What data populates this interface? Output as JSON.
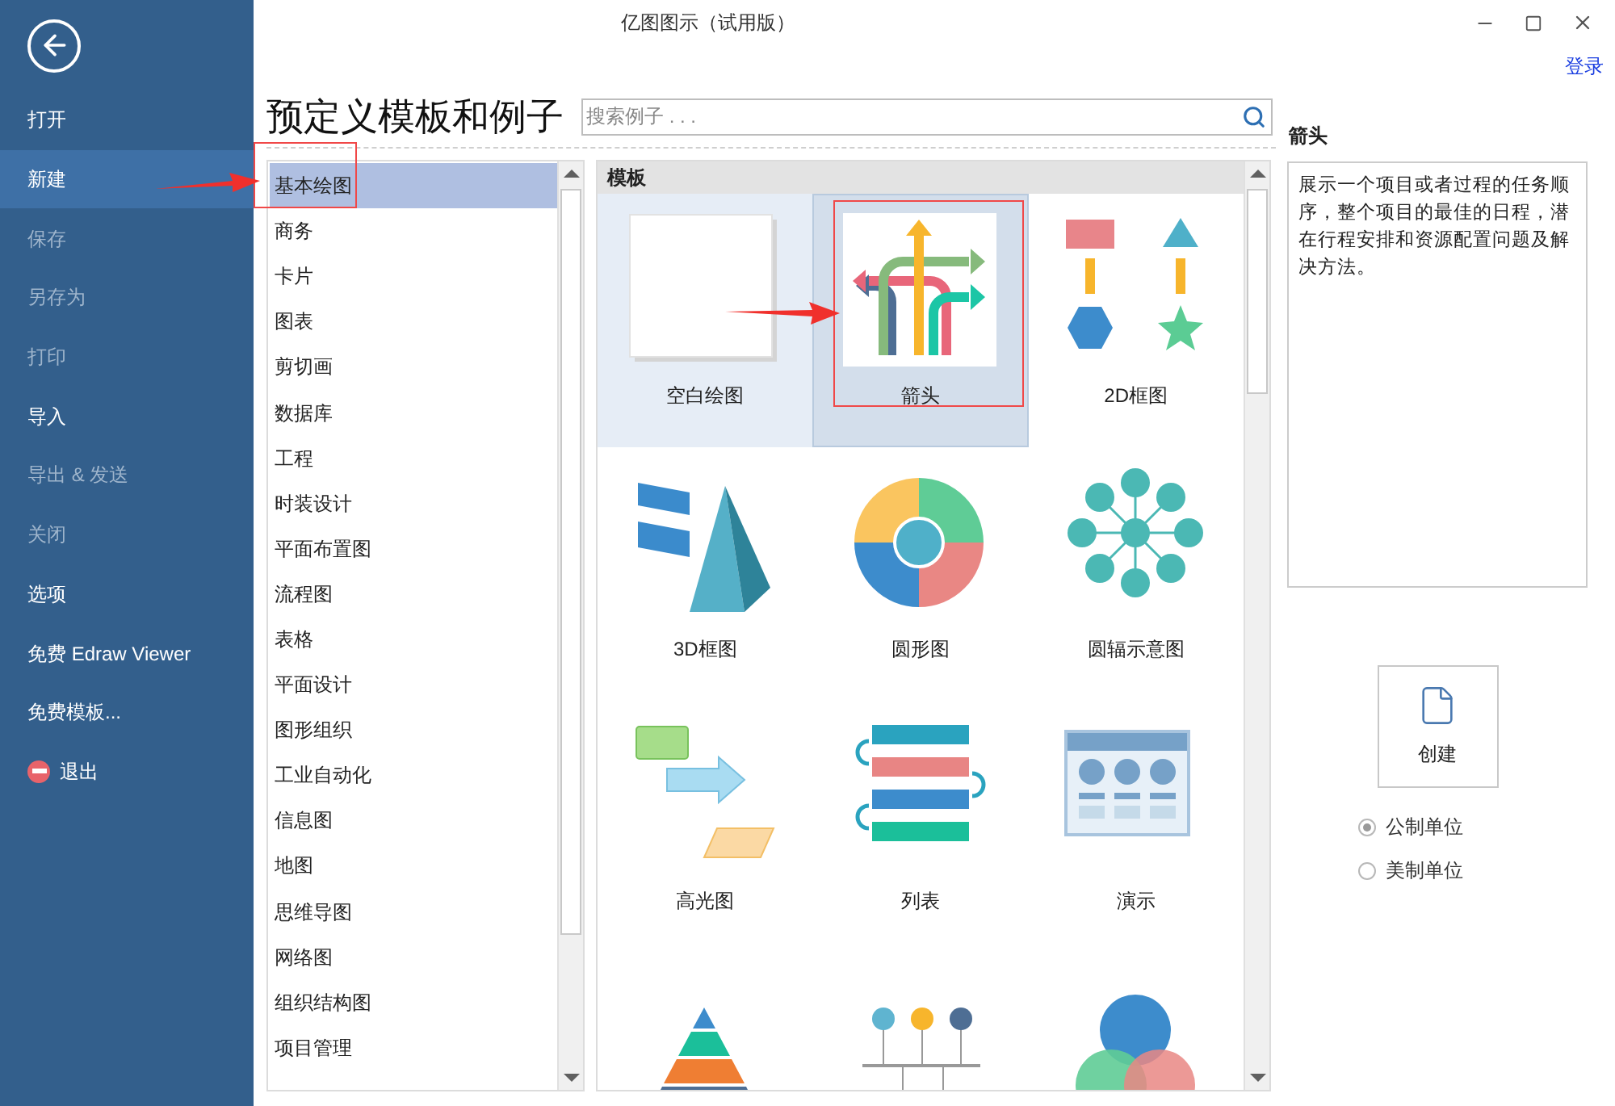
{
  "window": {
    "title": "亿图图示（试用版）",
    "login_link": "登录"
  },
  "sidebar": {
    "items": [
      {
        "label": "打开",
        "selected": false,
        "disabled": false,
        "kind": "text"
      },
      {
        "label": "新建",
        "selected": true,
        "disabled": false,
        "kind": "text"
      },
      {
        "label": "保存",
        "selected": false,
        "disabled": true,
        "kind": "text"
      },
      {
        "label": "另存为",
        "selected": false,
        "disabled": true,
        "kind": "text"
      },
      {
        "label": "打印",
        "selected": false,
        "disabled": true,
        "kind": "text"
      },
      {
        "label": "导入",
        "selected": false,
        "disabled": false,
        "kind": "text"
      },
      {
        "label": "导出 & 发送",
        "selected": false,
        "disabled": true,
        "kind": "text"
      },
      {
        "label": "关闭",
        "selected": false,
        "disabled": true,
        "kind": "text"
      },
      {
        "label": "选项",
        "selected": false,
        "disabled": false,
        "kind": "text"
      },
      {
        "label": "免费 Edraw Viewer",
        "selected": false,
        "disabled": false,
        "kind": "text"
      },
      {
        "label": "免费模板...",
        "selected": false,
        "disabled": false,
        "kind": "text"
      },
      {
        "label": "退出",
        "selected": false,
        "disabled": false,
        "kind": "exit"
      }
    ]
  },
  "heading": "预定义模板和例子",
  "search": {
    "placeholder": "搜索例子 . . ."
  },
  "categories": [
    {
      "label": "基本绘图",
      "selected": true
    },
    {
      "label": "商务",
      "selected": false
    },
    {
      "label": "卡片",
      "selected": false
    },
    {
      "label": "图表",
      "selected": false
    },
    {
      "label": "剪切画",
      "selected": false
    },
    {
      "label": "数据库",
      "selected": false
    },
    {
      "label": "工程",
      "selected": false
    },
    {
      "label": "时装设计",
      "selected": false
    },
    {
      "label": "平面布置图",
      "selected": false
    },
    {
      "label": "流程图",
      "selected": false
    },
    {
      "label": "表格",
      "selected": false
    },
    {
      "label": "平面设计",
      "selected": false
    },
    {
      "label": "图形组织",
      "selected": false
    },
    {
      "label": "工业自动化",
      "selected": false
    },
    {
      "label": "信息图",
      "selected": false
    },
    {
      "label": "地图",
      "selected": false
    },
    {
      "label": "思维导图",
      "selected": false
    },
    {
      "label": "网络图",
      "selected": false
    },
    {
      "label": "组织结构图",
      "selected": false
    },
    {
      "label": "项目管理",
      "selected": false
    }
  ],
  "templates": {
    "header": "模板",
    "items": [
      {
        "label": "空白绘图",
        "kind": "blank",
        "selected": false,
        "hovered": true
      },
      {
        "label": "箭头",
        "kind": "arrows",
        "selected": true,
        "hovered": false
      },
      {
        "label": "2D框图",
        "kind": "blocks2d",
        "selected": false,
        "hovered": false
      },
      {
        "label": "3D框图",
        "kind": "blocks3d",
        "selected": false,
        "hovered": false
      },
      {
        "label": "圆形图",
        "kind": "circular",
        "selected": false,
        "hovered": false
      },
      {
        "label": "圆辐示意图",
        "kind": "radial",
        "selected": false,
        "hovered": false
      },
      {
        "label": "高光图",
        "kind": "highlight",
        "selected": false,
        "hovered": false
      },
      {
        "label": "列表",
        "kind": "list",
        "selected": false,
        "hovered": false
      },
      {
        "label": "演示",
        "kind": "presentation",
        "selected": false,
        "hovered": false
      },
      {
        "kind": "pyramid",
        "selected": false,
        "hovered": false
      },
      {
        "kind": "timeline",
        "selected": false,
        "hovered": false
      },
      {
        "kind": "venn",
        "selected": false,
        "hovered": false
      }
    ]
  },
  "details": {
    "title": "箭头",
    "description": "展示一个项目或者过程的任务顺序，整个项目的最佳的日程，潜在行程安排和资源配置问题及解决方法。",
    "create_button": "创建",
    "units": [
      {
        "label": "公制单位",
        "selected": true
      },
      {
        "label": "美制单位",
        "selected": false
      }
    ]
  }
}
